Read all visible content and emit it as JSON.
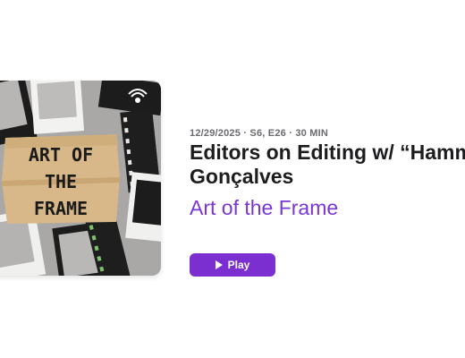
{
  "episode": {
    "date": "12/29/2025",
    "season_episode": "S6, E26",
    "duration": "30 MIN",
    "meta_line": "12/29/2025 · S6, E26 · 30 MIN",
    "title_line1": "Editors on Editing w/ “Hammy",
    "title_line2": "Gonçalves",
    "show_name": "Art of the Frame"
  },
  "artwork": {
    "label_line1": "ART OF",
    "label_line2": "THE",
    "label_line3": "FRAME",
    "brand_icon": "anchor-podcast-icon"
  },
  "actions": {
    "play_label": "Play",
    "play_icon": "play-icon"
  },
  "colors": {
    "accent": "#7b2fd0",
    "show_name": "#7a36d6",
    "meta_text": "#6b6b70",
    "title_text": "#1d1d1f",
    "artwork_bg": "#a9a8a6",
    "tape": "#d8b889"
  }
}
